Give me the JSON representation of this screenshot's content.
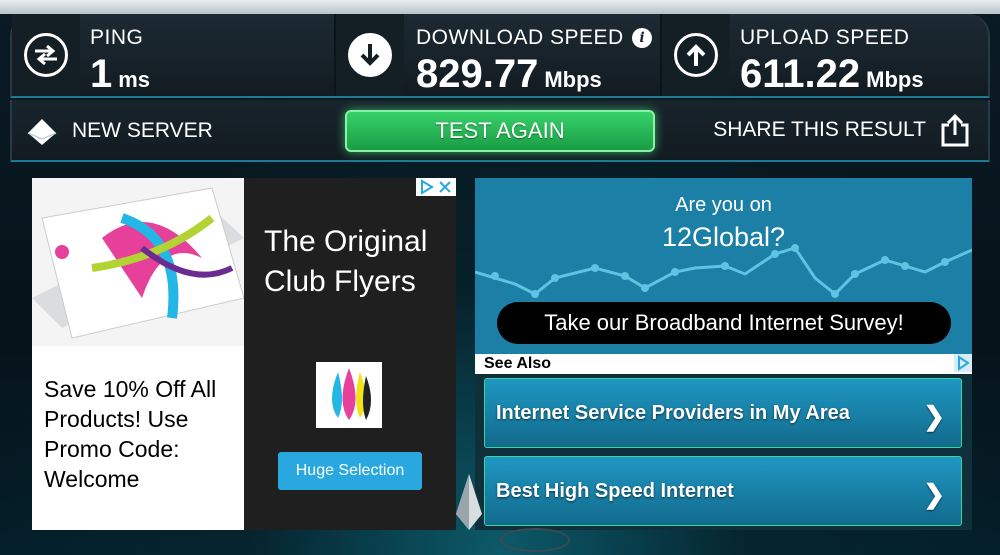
{
  "metrics": {
    "ping": {
      "label": "PING",
      "value": "1",
      "unit": "ms",
      "icon": "ping-arrows-icon"
    },
    "download": {
      "label": "DOWNLOAD SPEED",
      "value": "829.77",
      "unit": "Mbps",
      "icon": "download-arrow-icon",
      "info": "i"
    },
    "upload": {
      "label": "UPLOAD SPEED",
      "value": "611.22",
      "unit": "Mbps",
      "icon": "upload-arrow-icon"
    }
  },
  "actions": {
    "new_server": "NEW SERVER",
    "test_again": "TEST AGAIN",
    "share": "SHARE THIS RESULT"
  },
  "ad": {
    "title": "The Original Club Flyers",
    "promo": "Save 10% Off All Products! Use Promo Code: Welcome",
    "button": "Huge Selection"
  },
  "survey": {
    "line1": "Are you on",
    "line2": "12Global?",
    "button": "Take our Broadband Internet Survey!"
  },
  "see_also": {
    "label": "See Also",
    "links": [
      {
        "label": "Internet Service Providers in My Area"
      },
      {
        "label": "Best High Speed Internet"
      }
    ]
  },
  "colors": {
    "accent": "#1e7a93",
    "test_button": "#2bbd57",
    "survey_bg": "#1b7fa6",
    "ad_button": "#29a8e0"
  }
}
